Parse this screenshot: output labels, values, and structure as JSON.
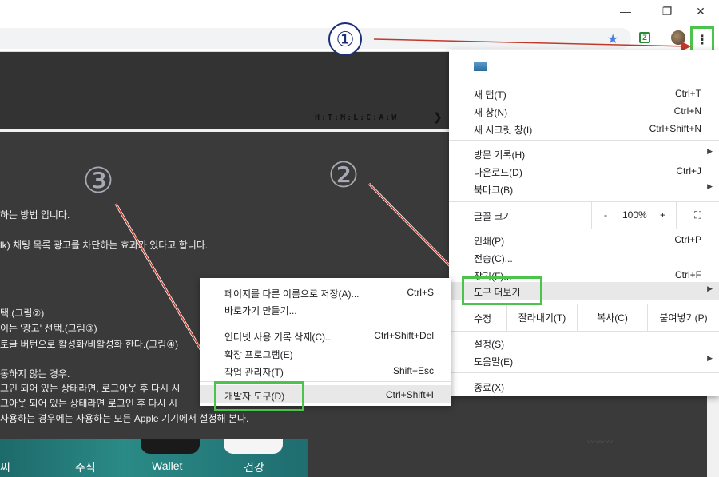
{
  "window": {
    "minimize": "—",
    "restore": "❐",
    "close": "✕"
  },
  "toolbar": {
    "star_icon": "star-icon",
    "kebab": "⋮"
  },
  "page": {
    "logo": "H:T:M:L:C:A:W",
    "lines": [
      "하는 방법 입니다.",
      "lk) 채팅 목록 광고를 차단하는 효과가 있다고 합니다.",
      "택.(그림②)",
      "이는 '광고' 선택.(그림③)",
      "토글 버턴으로 활성화/비활성화 한다.(그림④)",
      "동하지 않는 경우.",
      "그인 되어 있는 상태라면, 로그아웃 후 다시 시",
      "그아웃 되어 있는 상태라면 로그인 후 다시 시",
      "사용하는 경우에는 사용하는 모든 Apple 기기에서 설정해 본다."
    ],
    "apps": [
      "씨",
      "주식",
      "Wallet",
      "건강"
    ]
  },
  "annotations": {
    "step1": "①",
    "step2": "②",
    "step3": "③"
  },
  "menu": {
    "new_tab": {
      "label": "새 탭(T)",
      "shortcut": "Ctrl+T"
    },
    "new_window": {
      "label": "새 창(N)",
      "shortcut": "Ctrl+N"
    },
    "new_incognito": {
      "label": "새 시크릿 창(I)",
      "shortcut": "Ctrl+Shift+N"
    },
    "history": {
      "label": "방문 기록(H)"
    },
    "downloads": {
      "label": "다운로드(D)",
      "shortcut": "Ctrl+J"
    },
    "bookmarks": {
      "label": "북마크(B)"
    },
    "zoom": {
      "label": "글꼴 크기",
      "minus": "-",
      "value": "100%",
      "plus": "+"
    },
    "print": {
      "label": "인쇄(P)",
      "shortcut": "Ctrl+P"
    },
    "cast": {
      "label": "전송(C)..."
    },
    "find": {
      "label": "찾기(F)...",
      "shortcut": "Ctrl+F"
    },
    "more_tools": {
      "label": "도구 더보기"
    },
    "edit": {
      "label": "수정",
      "cut": "잘라내기(T)",
      "copy": "복사(C)",
      "paste": "붙여넣기(P)"
    },
    "settings": {
      "label": "설정(S)"
    },
    "help": {
      "label": "도움말(E)"
    },
    "exit": {
      "label": "종료(X)"
    }
  },
  "submenu": {
    "save_page": {
      "label": "페이지를 다른 이름으로 저장(A)...",
      "shortcut": "Ctrl+S"
    },
    "create_shortcut": {
      "label": "바로가기 만들기..."
    },
    "clear_data": {
      "label": "인터넷 사용 기록 삭제(C)...",
      "shortcut": "Ctrl+Shift+Del"
    },
    "extensions": {
      "label": "확장 프로그램(E)"
    },
    "task_manager": {
      "label": "작업 관리자(T)",
      "shortcut": "Shift+Esc"
    },
    "dev_tools": {
      "label": "개발자 도구(D)",
      "shortcut": "Ctrl+Shift+I"
    }
  },
  "colors": {
    "highlight": "#4cc34a",
    "page_bg": "#3a3a3a"
  }
}
